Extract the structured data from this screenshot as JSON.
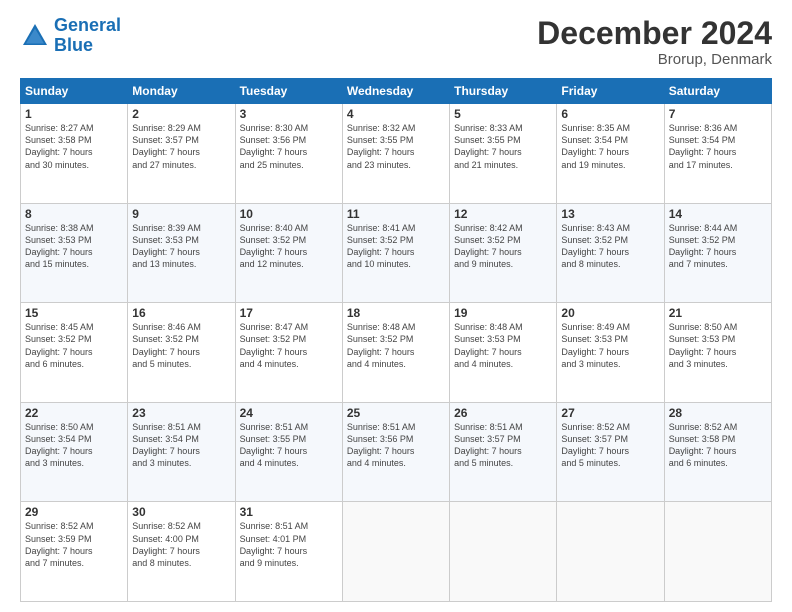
{
  "header": {
    "logo_line1": "General",
    "logo_line2": "Blue",
    "title": "December 2024",
    "subtitle": "Brorup, Denmark"
  },
  "weekdays": [
    "Sunday",
    "Monday",
    "Tuesday",
    "Wednesday",
    "Thursday",
    "Friday",
    "Saturday"
  ],
  "weeks": [
    [
      {
        "day": "1",
        "info": "Sunrise: 8:27 AM\nSunset: 3:58 PM\nDaylight: 7 hours\nand 30 minutes."
      },
      {
        "day": "2",
        "info": "Sunrise: 8:29 AM\nSunset: 3:57 PM\nDaylight: 7 hours\nand 27 minutes."
      },
      {
        "day": "3",
        "info": "Sunrise: 8:30 AM\nSunset: 3:56 PM\nDaylight: 7 hours\nand 25 minutes."
      },
      {
        "day": "4",
        "info": "Sunrise: 8:32 AM\nSunset: 3:55 PM\nDaylight: 7 hours\nand 23 minutes."
      },
      {
        "day": "5",
        "info": "Sunrise: 8:33 AM\nSunset: 3:55 PM\nDaylight: 7 hours\nand 21 minutes."
      },
      {
        "day": "6",
        "info": "Sunrise: 8:35 AM\nSunset: 3:54 PM\nDaylight: 7 hours\nand 19 minutes."
      },
      {
        "day": "7",
        "info": "Sunrise: 8:36 AM\nSunset: 3:54 PM\nDaylight: 7 hours\nand 17 minutes."
      }
    ],
    [
      {
        "day": "8",
        "info": "Sunrise: 8:38 AM\nSunset: 3:53 PM\nDaylight: 7 hours\nand 15 minutes."
      },
      {
        "day": "9",
        "info": "Sunrise: 8:39 AM\nSunset: 3:53 PM\nDaylight: 7 hours\nand 13 minutes."
      },
      {
        "day": "10",
        "info": "Sunrise: 8:40 AM\nSunset: 3:52 PM\nDaylight: 7 hours\nand 12 minutes."
      },
      {
        "day": "11",
        "info": "Sunrise: 8:41 AM\nSunset: 3:52 PM\nDaylight: 7 hours\nand 10 minutes."
      },
      {
        "day": "12",
        "info": "Sunrise: 8:42 AM\nSunset: 3:52 PM\nDaylight: 7 hours\nand 9 minutes."
      },
      {
        "day": "13",
        "info": "Sunrise: 8:43 AM\nSunset: 3:52 PM\nDaylight: 7 hours\nand 8 minutes."
      },
      {
        "day": "14",
        "info": "Sunrise: 8:44 AM\nSunset: 3:52 PM\nDaylight: 7 hours\nand 7 minutes."
      }
    ],
    [
      {
        "day": "15",
        "info": "Sunrise: 8:45 AM\nSunset: 3:52 PM\nDaylight: 7 hours\nand 6 minutes."
      },
      {
        "day": "16",
        "info": "Sunrise: 8:46 AM\nSunset: 3:52 PM\nDaylight: 7 hours\nand 5 minutes."
      },
      {
        "day": "17",
        "info": "Sunrise: 8:47 AM\nSunset: 3:52 PM\nDaylight: 7 hours\nand 4 minutes."
      },
      {
        "day": "18",
        "info": "Sunrise: 8:48 AM\nSunset: 3:52 PM\nDaylight: 7 hours\nand 4 minutes."
      },
      {
        "day": "19",
        "info": "Sunrise: 8:48 AM\nSunset: 3:53 PM\nDaylight: 7 hours\nand 4 minutes."
      },
      {
        "day": "20",
        "info": "Sunrise: 8:49 AM\nSunset: 3:53 PM\nDaylight: 7 hours\nand 3 minutes."
      },
      {
        "day": "21",
        "info": "Sunrise: 8:50 AM\nSunset: 3:53 PM\nDaylight: 7 hours\nand 3 minutes."
      }
    ],
    [
      {
        "day": "22",
        "info": "Sunrise: 8:50 AM\nSunset: 3:54 PM\nDaylight: 7 hours\nand 3 minutes."
      },
      {
        "day": "23",
        "info": "Sunrise: 8:51 AM\nSunset: 3:54 PM\nDaylight: 7 hours\nand 3 minutes."
      },
      {
        "day": "24",
        "info": "Sunrise: 8:51 AM\nSunset: 3:55 PM\nDaylight: 7 hours\nand 4 minutes."
      },
      {
        "day": "25",
        "info": "Sunrise: 8:51 AM\nSunset: 3:56 PM\nDaylight: 7 hours\nand 4 minutes."
      },
      {
        "day": "26",
        "info": "Sunrise: 8:51 AM\nSunset: 3:57 PM\nDaylight: 7 hours\nand 5 minutes."
      },
      {
        "day": "27",
        "info": "Sunrise: 8:52 AM\nSunset: 3:57 PM\nDaylight: 7 hours\nand 5 minutes."
      },
      {
        "day": "28",
        "info": "Sunrise: 8:52 AM\nSunset: 3:58 PM\nDaylight: 7 hours\nand 6 minutes."
      }
    ],
    [
      {
        "day": "29",
        "info": "Sunrise: 8:52 AM\nSunset: 3:59 PM\nDaylight: 7 hours\nand 7 minutes."
      },
      {
        "day": "30",
        "info": "Sunrise: 8:52 AM\nSunset: 4:00 PM\nDaylight: 7 hours\nand 8 minutes."
      },
      {
        "day": "31",
        "info": "Sunrise: 8:51 AM\nSunset: 4:01 PM\nDaylight: 7 hours\nand 9 minutes."
      },
      {
        "day": "",
        "info": ""
      },
      {
        "day": "",
        "info": ""
      },
      {
        "day": "",
        "info": ""
      },
      {
        "day": "",
        "info": ""
      }
    ]
  ]
}
